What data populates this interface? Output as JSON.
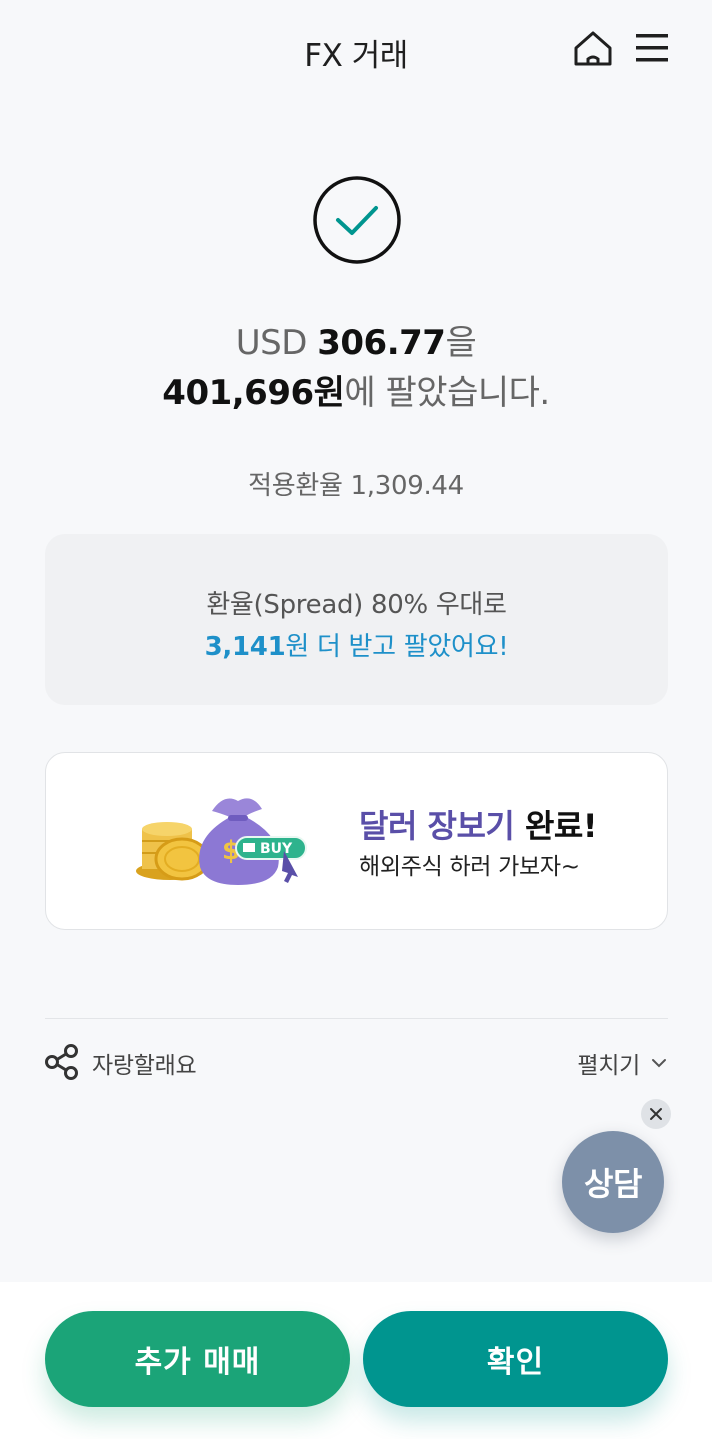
{
  "header": {
    "title": "FX 거래",
    "home_icon": "home-icon",
    "menu_icon": "hamburger-menu-icon"
  },
  "result": {
    "currency": "USD",
    "amount": "306.77",
    "amount_suffix": "을",
    "won_amount": "401,696원",
    "won_suffix": "에 팔았습니다."
  },
  "rate": {
    "label": "적용환율",
    "value": "1,309.44"
  },
  "spread": {
    "line1": "환율(Spread) 80% 우대로",
    "bonus_amount": "3,141",
    "bonus_suffix": "원 더 받고 팔았어요!"
  },
  "promo": {
    "title_accent": "달러 장보기",
    "title_dark": "완료!",
    "subtitle": "해외주식 하러 가보자~",
    "badge": "BUY"
  },
  "share": {
    "label": "자랑할래요",
    "expand_label": "펼치기"
  },
  "floating": {
    "consult_label": "상담"
  },
  "buttons": {
    "more_trade": "추가 매매",
    "confirm": "확인"
  },
  "colors": {
    "green_button": "#1ba478",
    "teal_button": "#00958f",
    "highlight_blue": "#1e90c9",
    "promo_purple": "#5a4fa8",
    "consult_slate": "#7d90a9"
  }
}
